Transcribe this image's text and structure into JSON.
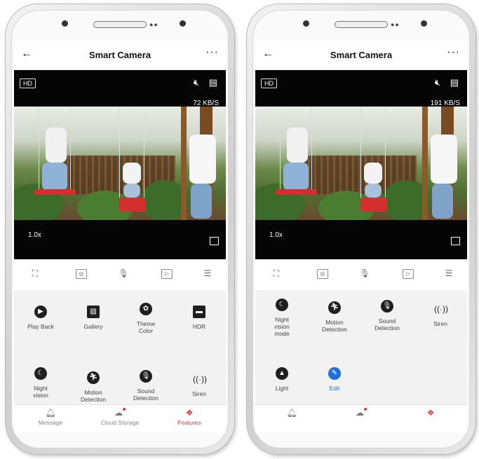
{
  "left": {
    "title": "Smart Camera",
    "quality": "HD",
    "rate": "72 KB/S",
    "zoom": "1.0x",
    "features": [
      {
        "label": "Play Back",
        "icon": "play-icon"
      },
      {
        "label": "Gallery",
        "icon": "gallery-icon"
      },
      {
        "label": "Theme\nColor",
        "icon": "palette-icon"
      },
      {
        "label": "HDR",
        "icon": "hdr-icon"
      },
      {
        "label": "Night\nvision",
        "icon": "moon-icon"
      },
      {
        "label": "Motion\nDetection",
        "icon": "motion-icon"
      },
      {
        "label": "Sound\nDetection",
        "icon": "microphone-icon"
      },
      {
        "label": "Siren",
        "icon": "siren-icon"
      }
    ],
    "tabs": [
      {
        "label": "Message",
        "icon": "bell-icon"
      },
      {
        "label": "Cloud Storage",
        "icon": "cloud-icon"
      },
      {
        "label": "Features",
        "icon": "features-icon"
      }
    ]
  },
  "right": {
    "title": "Smart Camera",
    "quality": "HD",
    "rate": "191 KB/S",
    "zoom": "1.0x",
    "features": [
      {
        "label": "Night\nvision\nmode",
        "icon": "moon-icon"
      },
      {
        "label": "Motion\nDetection",
        "icon": "motion-icon"
      },
      {
        "label": "Sound\nDetection",
        "icon": "microphone-icon"
      },
      {
        "label": "Siren",
        "icon": "siren-icon"
      },
      {
        "label": "Light",
        "icon": "light-icon"
      },
      {
        "label": "Edit",
        "icon": "edit-icon"
      }
    ]
  },
  "colors": {
    "accent": "#e53935",
    "edit": "#1e6fd9"
  }
}
